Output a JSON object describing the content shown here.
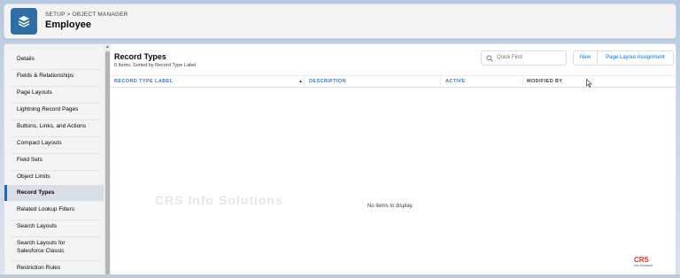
{
  "header": {
    "breadcrumb": "SETUP > OBJECT MANAGER",
    "title": "Employee"
  },
  "sidebar": {
    "items": [
      {
        "label": "Details"
      },
      {
        "label": "Fields & Relationships"
      },
      {
        "label": "Page Layouts"
      },
      {
        "label": "Lightning Record Pages"
      },
      {
        "label": "Buttons, Links, and Actions"
      },
      {
        "label": "Compact Layouts"
      },
      {
        "label": "Field Sets"
      },
      {
        "label": "Object Limits"
      },
      {
        "label": "Record Types"
      },
      {
        "label": "Related Lookup Filters"
      },
      {
        "label": "Search Layouts"
      },
      {
        "label_line1": "Search Layouts for",
        "label_line2": "Salesforce Classic"
      },
      {
        "label": "Restriction Rules"
      }
    ],
    "active_item": "Record Types"
  },
  "content": {
    "title": "Record Types",
    "subtitle": "0 Items, Sorted by Record Type Label",
    "quick_find_placeholder": "Quick Find",
    "new_button": "New",
    "page_layout_assignment_button": "Page Layout Assignment",
    "columns": [
      "RECORD TYPE LABEL",
      "DESCRIPTION",
      "ACTIVE",
      "MODIFIED BY"
    ],
    "empty_message": "No items to display."
  },
  "watermark": "CRS Info Solutions",
  "logo": {
    "main": "CRS",
    "sub": "Info Solutions"
  },
  "colors": {
    "accent": "#0070d2",
    "header_icon": "#2f6ea4",
    "logo_red": "#d9342b"
  }
}
